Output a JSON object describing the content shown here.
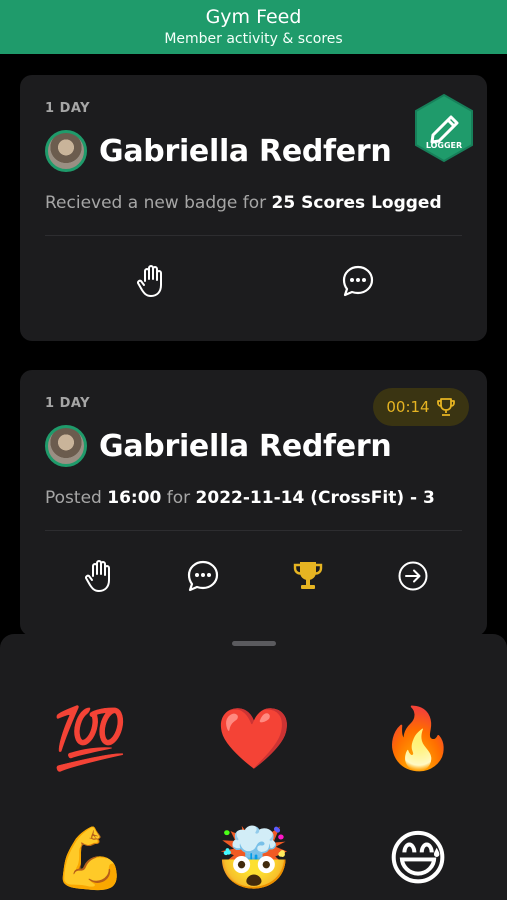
{
  "header": {
    "title": "Gym Feed",
    "subtitle": "Member activity & scores"
  },
  "feed": [
    {
      "day": "1 DAY",
      "user": "Gabriella Redfern",
      "activity_prefix": "Recieved a new badge for ",
      "activity_bold": "25 Scores Logged",
      "badge_label": "LOGGER",
      "actions": [
        "hand-icon",
        "comment-icon"
      ]
    },
    {
      "day": "1 DAY",
      "user": "Gabriella Redfern",
      "activity_prefix": "Posted ",
      "time_bold": "16:00",
      "activity_middle": " for ",
      "workout_bold": "2022-11-14 (CrossFit) - 3",
      "timer": "00:14",
      "actions": [
        "hand-icon",
        "comment-icon",
        "trophy-icon",
        "arrow-right-circle-icon"
      ]
    }
  ],
  "reactions": [
    "💯",
    "❤️",
    "🔥",
    "💪",
    "🤯",
    "😅"
  ],
  "colors": {
    "brand": "#1f9b6b",
    "gold": "#e6b422",
    "card": "#1c1c1e"
  }
}
